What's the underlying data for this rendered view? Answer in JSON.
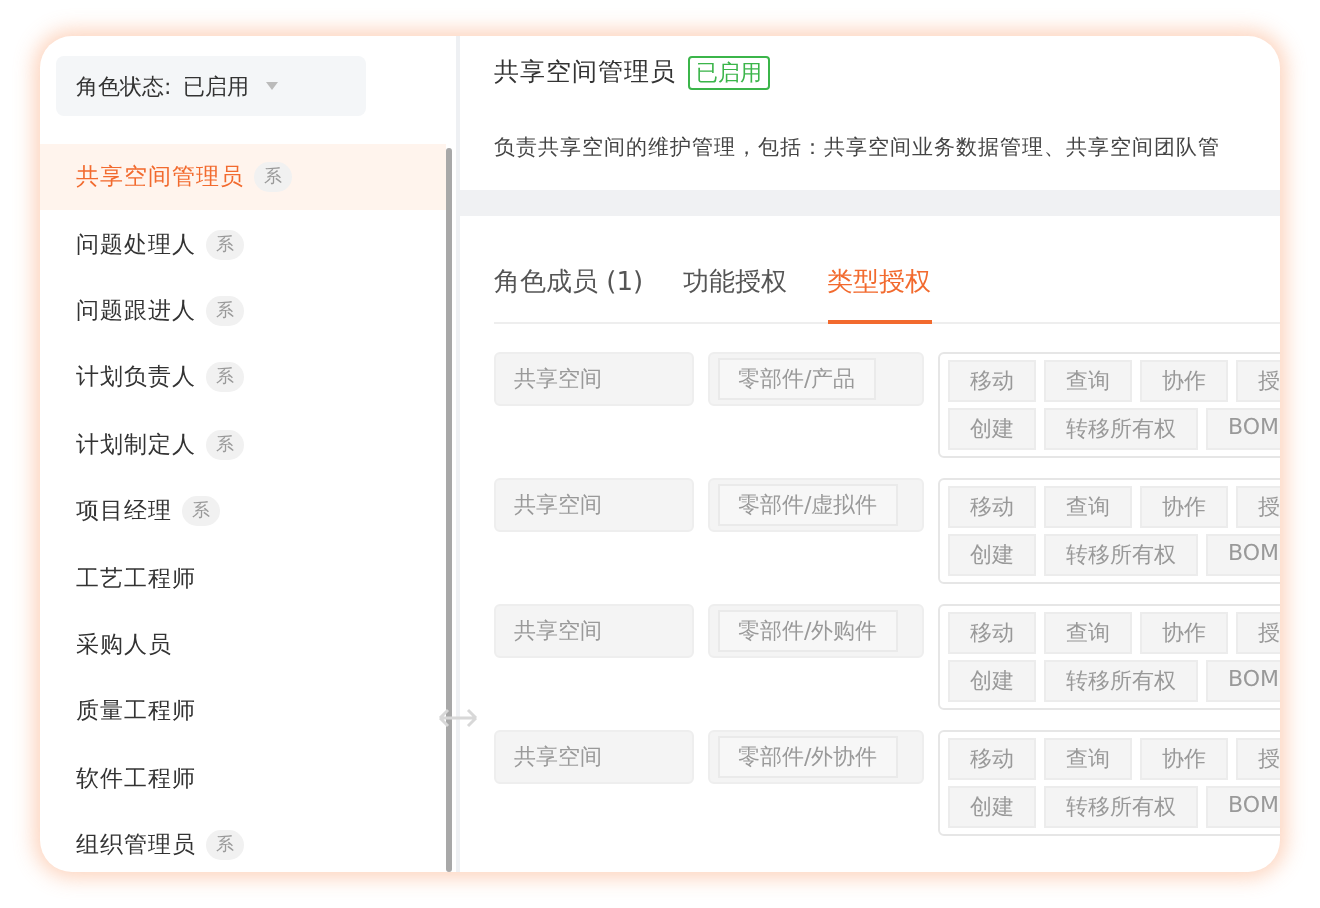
{
  "filter": {
    "label": "角色状态:",
    "value": "已启用"
  },
  "roles": [
    {
      "name": "共享空间管理员",
      "badge": "系",
      "selected": true
    },
    {
      "name": "问题处理人",
      "badge": "系",
      "selected": false
    },
    {
      "name": "问题跟进人",
      "badge": "系",
      "selected": false
    },
    {
      "name": "计划负责人",
      "badge": "系",
      "selected": false
    },
    {
      "name": "计划制定人",
      "badge": "系",
      "selected": false
    },
    {
      "name": "项目经理",
      "badge": "系",
      "selected": false
    },
    {
      "name": "工艺工程师",
      "selected": false
    },
    {
      "name": "采购人员",
      "selected": false
    },
    {
      "name": "质量工程师",
      "selected": false
    },
    {
      "name": "软件工程师",
      "selected": false
    },
    {
      "name": "组织管理员",
      "badge": "系",
      "selected": false
    }
  ],
  "detail": {
    "title": "共享空间管理员",
    "status": "已启用",
    "description": "负责共享空间的维护管理，包括：共享空间业务数据管理、共享空间团队管"
  },
  "tabs": [
    {
      "label": "角色成员 (1)",
      "selected": false
    },
    {
      "label": "功能授权",
      "selected": false
    },
    {
      "label": "类型授权",
      "selected": true
    }
  ],
  "rules": [
    {
      "space": "共享空间",
      "type": "零部件/产品",
      "permissions": [
        [
          "移动",
          "查询",
          "协作",
          "授"
        ],
        [
          "创建",
          "转移所有权",
          "BOM"
        ]
      ]
    },
    {
      "space": "共享空间",
      "type": "零部件/虚拟件",
      "permissions": [
        [
          "移动",
          "查询",
          "协作",
          "授"
        ],
        [
          "创建",
          "转移所有权",
          "BOM"
        ]
      ]
    },
    {
      "space": "共享空间",
      "type": "零部件/外购件",
      "permissions": [
        [
          "移动",
          "查询",
          "协作",
          "授"
        ],
        [
          "创建",
          "转移所有权",
          "BOM"
        ]
      ]
    },
    {
      "space": "共享空间",
      "type": "零部件/外协件",
      "permissions": [
        [
          "移动",
          "查询",
          "协作",
          "授"
        ],
        [
          "创建",
          "转移所有权",
          "BOM"
        ]
      ]
    }
  ]
}
